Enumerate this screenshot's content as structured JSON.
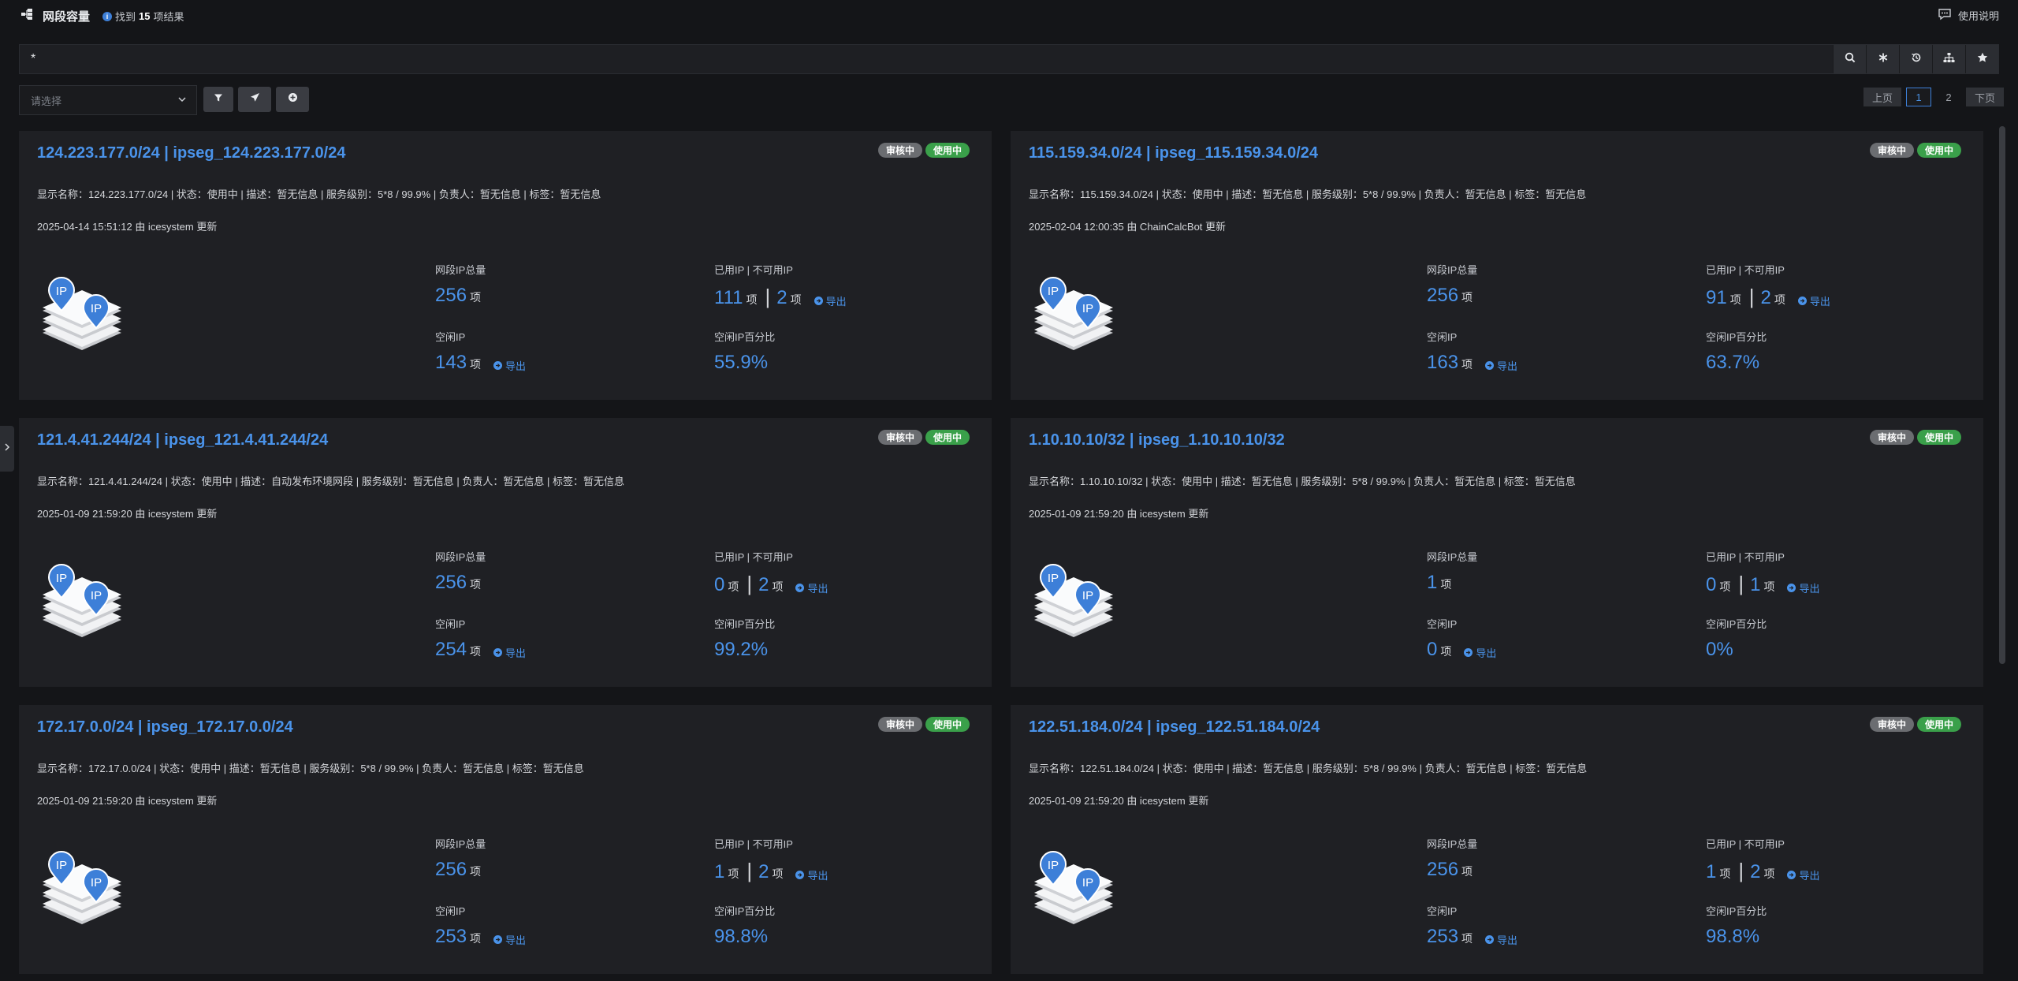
{
  "header": {
    "title": "网段容量",
    "result_prefix": "找到",
    "result_count": "15",
    "result_suffix": "项结果",
    "help_label": "使用说明"
  },
  "search": {
    "value": "*"
  },
  "filter": {
    "select_placeholder": "请选择"
  },
  "pager": {
    "prev_label": "上页",
    "pages": [
      "1",
      "2"
    ],
    "next_label": "下页"
  },
  "labels": {
    "total": "网段IP总量",
    "used": "已用IP | 不可用IP",
    "free": "空闲IP",
    "pct": "空闲IP百分比",
    "unit": "项",
    "export": "导出",
    "badge_review": "审核中",
    "badge_use": "使用中"
  },
  "cards": [
    {
      "title": "124.223.177.0/24 | ipseg_124.223.177.0/24",
      "meta": "显示名称：124.223.177.0/24 | 状态：使用中 | 描述：暂无信息 | 服务级别：5*8 / 99.9% | 负责人：暂无信息 | 标签：暂无信息",
      "updated": "2025-04-14 15:51:12 由 icesystem 更新",
      "total": "256",
      "used": "111",
      "unusable": "2",
      "free": "143",
      "pct": "55.9%"
    },
    {
      "title": "115.159.34.0/24 | ipseg_115.159.34.0/24",
      "meta": "显示名称：115.159.34.0/24 | 状态：使用中 | 描述：暂无信息 | 服务级别：5*8 / 99.9% | 负责人：暂无信息 | 标签：暂无信息",
      "updated": "2025-02-04 12:00:35 由 ChainCalcBot 更新",
      "total": "256",
      "used": "91",
      "unusable": "2",
      "free": "163",
      "pct": "63.7%"
    },
    {
      "title": "121.4.41.244/24 | ipseg_121.4.41.244/24",
      "meta": "显示名称：121.4.41.244/24 | 状态：使用中 | 描述：自动发布环境网段 | 服务级别：暂无信息 | 负责人：暂无信息 | 标签：暂无信息",
      "updated": "2025-01-09 21:59:20 由 icesystem 更新",
      "total": "256",
      "used": "0",
      "unusable": "2",
      "free": "254",
      "pct": "99.2%"
    },
    {
      "title": "1.10.10.10/32 | ipseg_1.10.10.10/32",
      "meta": "显示名称：1.10.10.10/32 | 状态：使用中 | 描述：暂无信息 | 服务级别：5*8 / 99.9% | 负责人：暂无信息 | 标签：暂无信息",
      "updated": "2025-01-09 21:59:20 由 icesystem 更新",
      "total": "1",
      "used": "0",
      "unusable": "1",
      "free": "0",
      "pct": "0%"
    },
    {
      "title": "172.17.0.0/24 | ipseg_172.17.0.0/24",
      "meta": "显示名称：172.17.0.0/24 | 状态：使用中 | 描述：暂无信息 | 服务级别：5*8 / 99.9% | 负责人：暂无信息 | 标签：暂无信息",
      "updated": "2025-01-09 21:59:20 由 icesystem 更新",
      "total": "256",
      "used": "1",
      "unusable": "2",
      "free": "253",
      "pct": "98.8%"
    },
    {
      "title": "122.51.184.0/24 | ipseg_122.51.184.0/24",
      "meta": "显示名称：122.51.184.0/24 | 状态：使用中 | 描述：暂无信息 | 服务级别：5*8 / 99.9% | 负责人：暂无信息 | 标签：暂无信息",
      "updated": "2025-01-09 21:59:20 由 icesystem 更新",
      "total": "256",
      "used": "1",
      "unusable": "2",
      "free": "253",
      "pct": "98.8%"
    }
  ],
  "icons": {
    "app": "network-tree-icon",
    "info": "info-icon",
    "help": "chat-bubble-icon",
    "search": "search-icon",
    "asterisk": "asterisk-icon",
    "history": "history-icon",
    "sitemap": "sitemap-icon",
    "star": "star-icon",
    "filter": "filter-icon",
    "send": "send-icon",
    "add": "add-circle-icon",
    "export": "export-arrow-icon",
    "illustration": "ip-layers-illustration"
  },
  "colors": {
    "accent": "#4a93ea",
    "badge_review": "#6b6d71",
    "badge_use": "#3aa04a",
    "card_bg": "#1f2024"
  }
}
